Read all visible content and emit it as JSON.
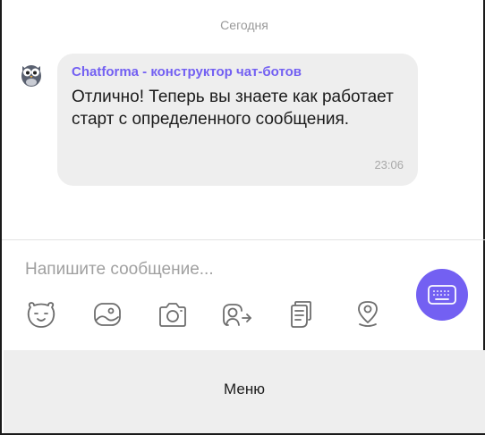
{
  "chat": {
    "date_separator": "Сегодня",
    "message": {
      "sender": "Chatforma - конструктор чат-ботов",
      "text": "Отлично! Теперь вы знаете как работает старт с определенного сообщения.",
      "time": "23:06"
    }
  },
  "composer": {
    "placeholder": "Напишите сообщение...",
    "toolbar_icons": [
      "sticker-icon",
      "gallery-icon",
      "camera-icon",
      "gif-icon",
      "file-icon",
      "location-icon"
    ],
    "keyboard_icon": "keyboard-icon"
  },
  "bot_menu": {
    "label": "Меню"
  },
  "colors": {
    "accent": "#7360f2",
    "bubble": "#eeeeee",
    "icon_stroke": "#6d6d6d"
  }
}
